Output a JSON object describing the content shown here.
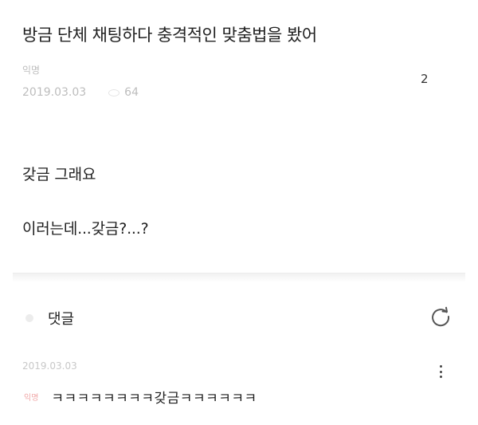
{
  "post": {
    "title": "방금 단체 채팅하다 충격적인 맞춤법을 봤어",
    "author": "익명",
    "date": "2019.03.03",
    "views": "64",
    "likes": "2",
    "body": [
      "갖금 그래요",
      "이러는데...갖금?...?"
    ]
  },
  "comments": {
    "header_label": "댓글",
    "items": [
      {
        "author": "익명",
        "date": "2019.03.03",
        "text": "ㅋㅋㅋㅋㅋㅋㅋㅋ갖금ㅋㅋㅋㅋㅋㅋ"
      }
    ]
  },
  "icons": {
    "views": "eye-icon",
    "comment_header": "comment-icon",
    "refresh": "refresh-icon",
    "more": "more-icon"
  }
}
